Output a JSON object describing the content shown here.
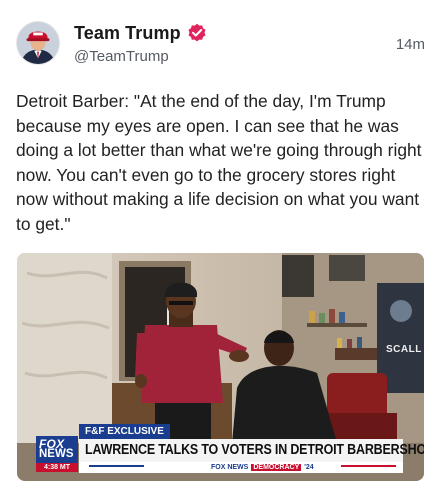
{
  "post": {
    "display_name": "Team Trump",
    "handle": "@TeamTrump",
    "timestamp": "14m",
    "text": "Detroit Barber: \"At the end of the day, I'm Trump because my eyes are open. I can see that he was doing a lot better than what we're going through right now. You can't even go to the grocery stores right now without making a life decision on what you want to get.\"",
    "avatar_icon": "profile-photo",
    "verified_icon": "verified-badge-icon",
    "verified_color": "#e0245e"
  },
  "media": {
    "chyron_tag": "F&F EXCLUSIVE",
    "chyron_headline": "LAWRENCE TALKS TO VOTERS IN DETROIT BARBERSHOP",
    "logo_top": "FOX",
    "logo_bottom": "NEWS",
    "logo_time": "4:38 MT",
    "bottom_brand": "FOX NEWS",
    "bottom_segment": "DEMOCRACY",
    "bottom_year": "'24",
    "wall_sign": "SCALL",
    "accent_blue": "#1b3d8f",
    "accent_red": "#c8102e"
  }
}
